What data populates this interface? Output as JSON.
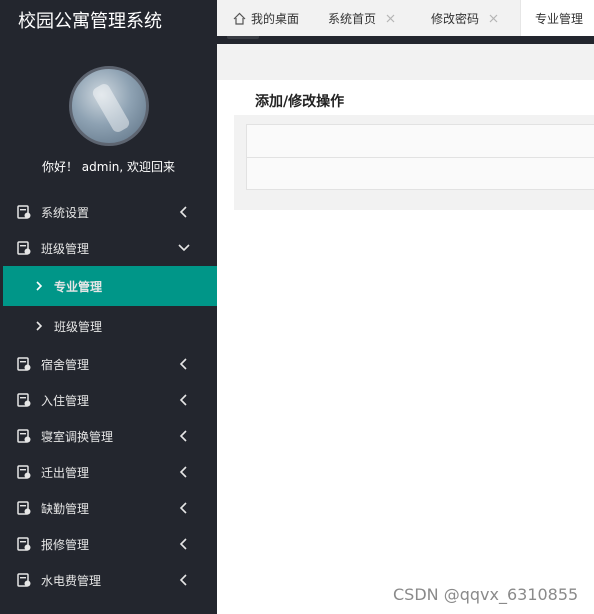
{
  "app": {
    "title": "校园公寓管理系统"
  },
  "user": {
    "greeting": "你好！ admin, 欢迎回来"
  },
  "sidebar": {
    "items": [
      {
        "label": "系统设置",
        "expanded": false
      },
      {
        "label": "班级管理",
        "expanded": true
      },
      {
        "label": "宿舍管理",
        "expanded": false
      },
      {
        "label": "入住管理",
        "expanded": false
      },
      {
        "label": "寝室调换管理",
        "expanded": false
      },
      {
        "label": "迁出管理",
        "expanded": false
      },
      {
        "label": "缺勤管理",
        "expanded": false
      },
      {
        "label": "报修管理",
        "expanded": false
      },
      {
        "label": "水电费管理",
        "expanded": false
      }
    ],
    "sub_items": [
      {
        "label": "专业管理",
        "active": true
      },
      {
        "label": "班级管理",
        "active": false
      }
    ]
  },
  "tabs": [
    {
      "label": "我的桌面",
      "closable": false,
      "active": false
    },
    {
      "label": "系统首页",
      "closable": true,
      "active": false
    },
    {
      "label": "修改密码",
      "closable": true,
      "active": false
    },
    {
      "label": "专业管理",
      "closable": false,
      "active": true
    }
  ],
  "content": {
    "title": "添加/修改操作"
  },
  "watermark": "CSDN @qqvx_6310855",
  "colors": {
    "sidebar_bg": "#23262e",
    "accent": "#009688"
  }
}
